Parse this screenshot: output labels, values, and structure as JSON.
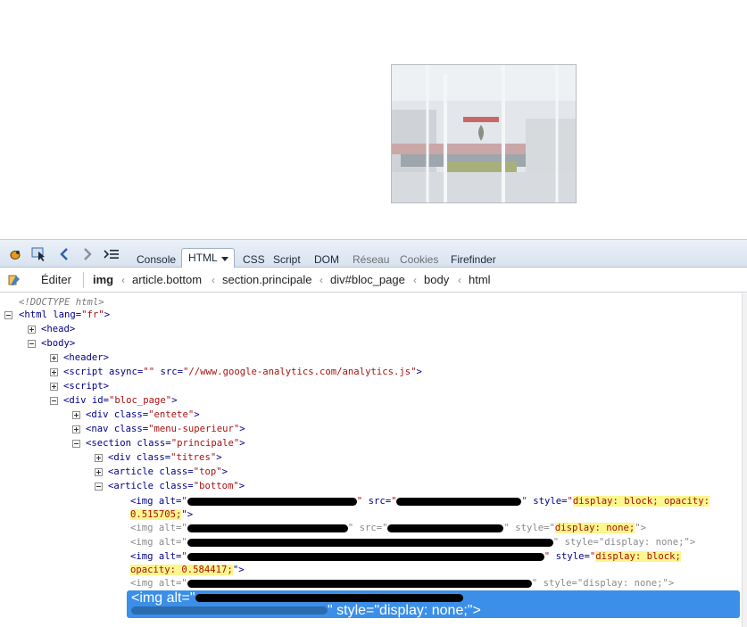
{
  "toolbar": {
    "icons": [
      "firebug-icon",
      "inspect-icon",
      "back-icon",
      "forward-icon",
      "command-line-icon"
    ],
    "tabs": [
      {
        "label": "Console",
        "muted": false
      },
      {
        "label": "HTML",
        "active": true
      },
      {
        "label": "CSS",
        "muted": false
      },
      {
        "label": "Script",
        "muted": false
      },
      {
        "label": "DOM",
        "muted": false
      },
      {
        "label": "Réseau",
        "muted": true
      },
      {
        "label": "Cookies",
        "muted": true
      },
      {
        "label": "Firefinder",
        "muted": false
      }
    ]
  },
  "breadcrumb": {
    "edit_label": "Éditer",
    "items": [
      "img",
      "article.bottom",
      "section.principale",
      "div#bloc_page",
      "body",
      "html"
    ]
  },
  "tree": {
    "doctype": "<!DOCTYPE html>",
    "html_open": [
      "<html",
      " lang=",
      "\"fr\"",
      ">"
    ],
    "head": "<head>",
    "body": "<body>",
    "header": "<header>",
    "script_async": [
      "<script",
      " async=",
      "\"\"",
      " src=",
      "\"//www.google-analytics.com/analytics.js\"",
      ">"
    ],
    "script": "<script>",
    "div_bloc": [
      "<div",
      " id=",
      "\"bloc_page\"",
      ">"
    ],
    "div_entete": [
      "<div",
      " class=",
      "\"entete\"",
      ">"
    ],
    "nav": [
      "<nav",
      " class=",
      "\"menu-superieur\"",
      ">"
    ],
    "section": [
      "<section",
      " class=",
      "\"principale\"",
      ">"
    ],
    "div_titres": [
      "<div",
      " class=",
      "\"titres\"",
      ">"
    ],
    "article_top": [
      "<article",
      " class=",
      "\"top\"",
      ">"
    ],
    "article_bottom": [
      "<article",
      " class=",
      "\"bottom\"",
      ">"
    ],
    "img_tag": "<img",
    "alt_attr": " alt=",
    "src_attr": " src=",
    "style_attr": " style=",
    "quote": "\"",
    "close": ">",
    "close_quote": "\">",
    "style_block_opacity_1": "display: block; opacity:",
    "style_block_opacity_1b": "0.515705;",
    "style_none": "display: none;",
    "style_block_opacity_2": "display: block;",
    "style_block_opacity_2b": "opacity: 0.584417;",
    "style_none_plain": "\"display: none;\">",
    "selected_row_tail": "\"display: none;\">"
  },
  "colors": {
    "selection": "#3b8fe8",
    "highlight": "#fbf68e",
    "tag": "#000088",
    "attr_value": "#aa1111"
  }
}
